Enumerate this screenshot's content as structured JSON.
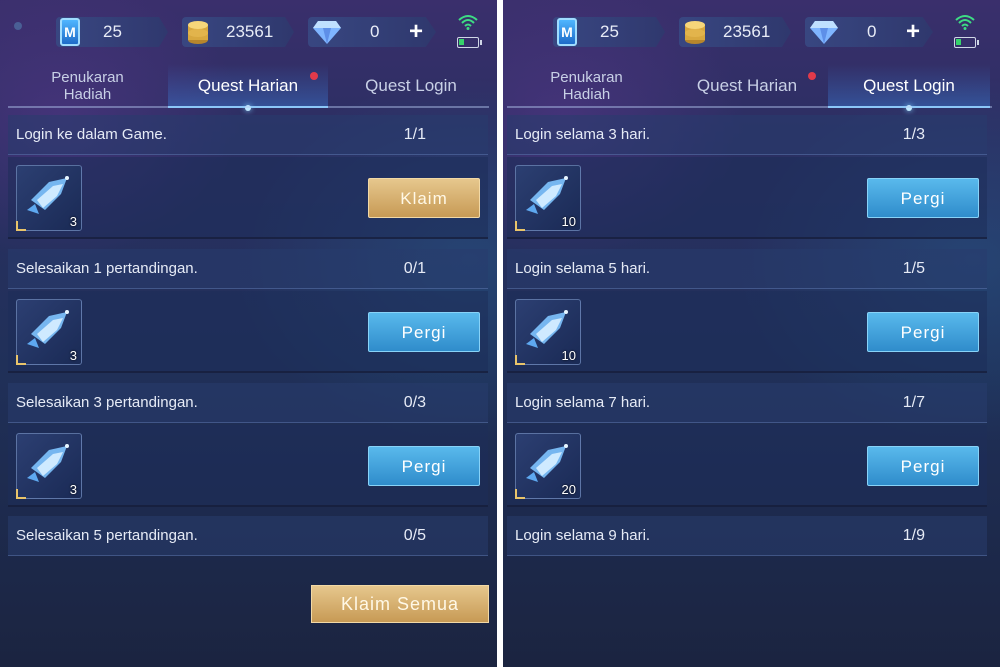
{
  "colors": {
    "accent_blue": "#59b9ec",
    "gold_button": "#d9b574",
    "notification_dot": "#e23a4a",
    "battery_green": "#36d36b"
  },
  "icons": [
    "ticket-icon",
    "coin-icon",
    "diamond-icon",
    "plus-icon",
    "wifi-icon",
    "battery-icon",
    "emblem-reward-icon"
  ],
  "left": {
    "resources": {
      "tickets": "25",
      "coins": "23561",
      "diamonds": "0",
      "ticket_letter": "M"
    },
    "tabs": [
      {
        "label": "Penukaran Hadiah",
        "line1": "Penukaran",
        "line2": "Hadiah"
      },
      {
        "label": "Quest Harian"
      },
      {
        "label": "Quest Login"
      }
    ],
    "active_tab": "Quest Harian",
    "quests": [
      {
        "title": "Login ke dalam Game.",
        "progress": "1/1",
        "reward_count": "3",
        "button": "Klaim"
      },
      {
        "title": "Selesaikan 1 pertandingan.",
        "progress": "0/1",
        "reward_count": "3",
        "button": "Pergi"
      },
      {
        "title": "Selesaikan 3 pertandingan.",
        "progress": "0/3",
        "reward_count": "3",
        "button": "Pergi"
      },
      {
        "title": "Selesaikan 5 pertandingan.",
        "progress": "0/5"
      }
    ],
    "claim_all": "Klaim Semua"
  },
  "right": {
    "resources": {
      "tickets": "25",
      "coins": "23561",
      "diamonds": "0",
      "ticket_letter": "M"
    },
    "tabs": [
      {
        "label": "Penukaran Hadiah",
        "line1": "Penukaran",
        "line2": "Hadiah"
      },
      {
        "label": "Quest Harian"
      },
      {
        "label": "Quest Login"
      }
    ],
    "active_tab": "Quest Login",
    "quests": [
      {
        "title": "Login selama 3 hari.",
        "progress": "1/3",
        "reward_count": "10",
        "button": "Pergi"
      },
      {
        "title": "Login selama 5 hari.",
        "progress": "1/5",
        "reward_count": "10",
        "button": "Pergi"
      },
      {
        "title": "Login selama 7 hari.",
        "progress": "1/7",
        "reward_count": "20",
        "button": "Pergi"
      },
      {
        "title": "Login selama 9 hari.",
        "progress": "1/9"
      }
    ]
  }
}
